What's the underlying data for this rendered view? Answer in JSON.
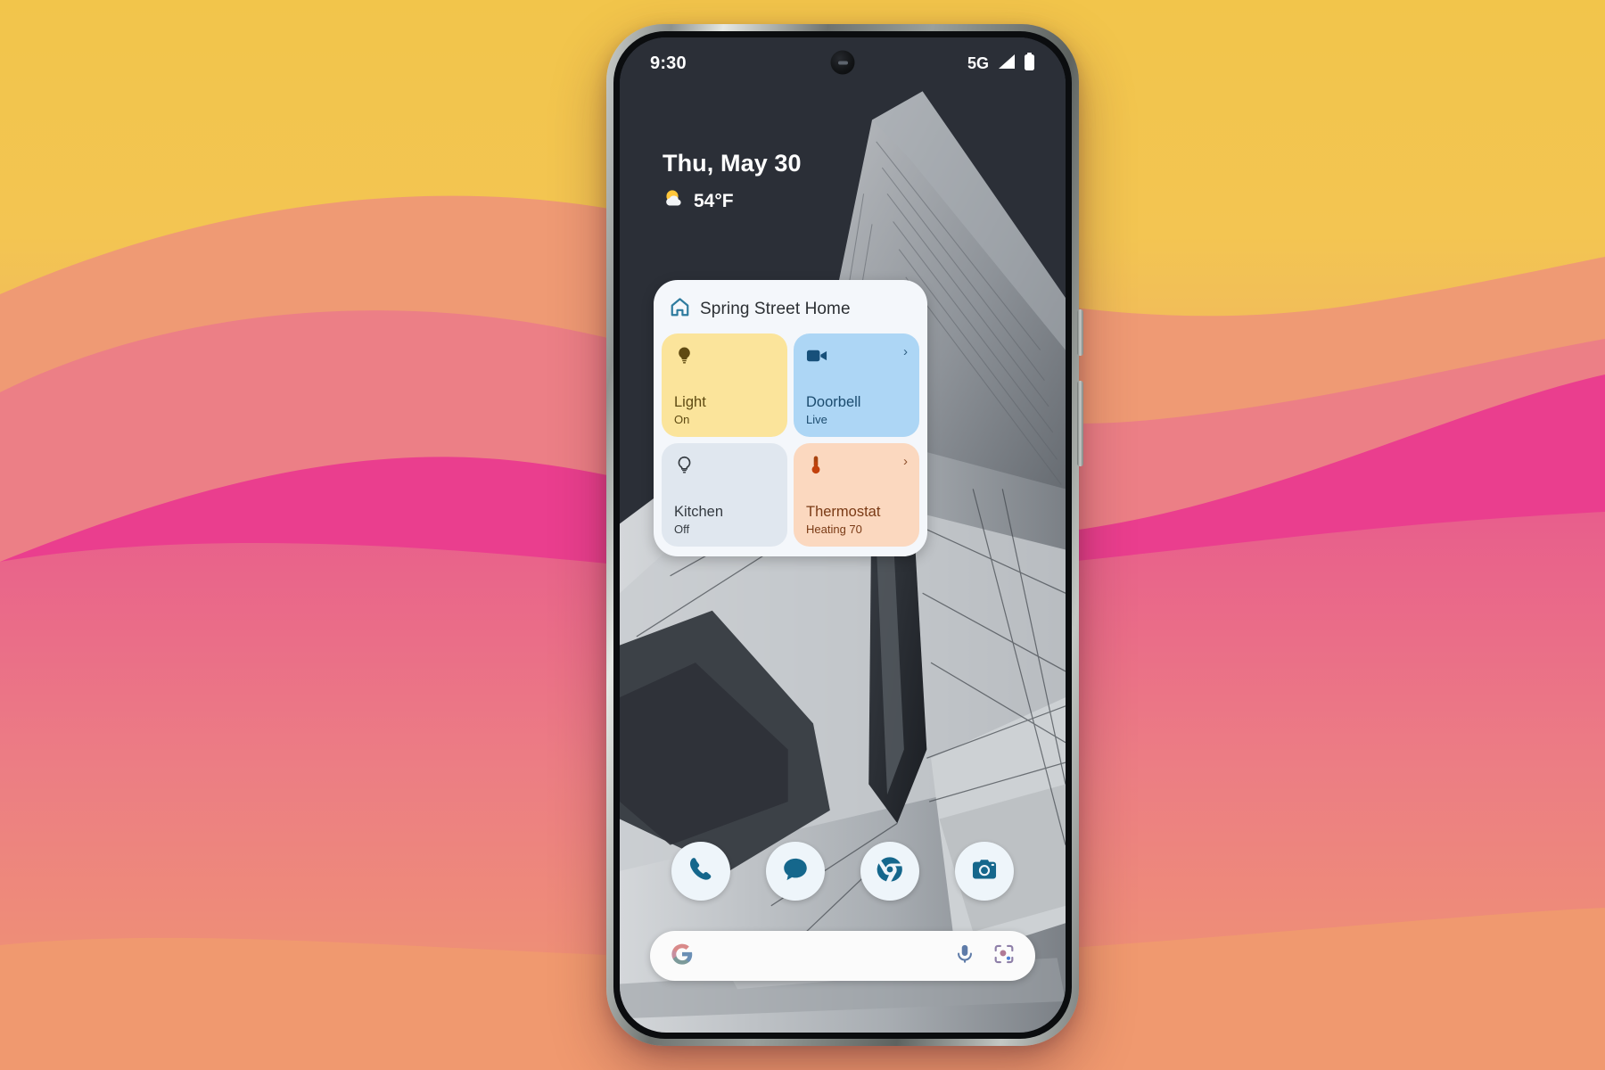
{
  "scene": {
    "background_colors": {
      "sky_top": "#F2C54B",
      "sky_mid": "#F0B264",
      "wave_salmon": "#EF9A74",
      "wave_coral": "#EC7F86",
      "wave_pink": "#E85E8C",
      "wave_magenta": "#EA3E8E",
      "wave_bottom": "#F0996F"
    }
  },
  "status_bar": {
    "time": "9:30",
    "network_label": "5G",
    "signal_icon": "signal-bars-icon",
    "battery_icon": "battery-full-icon",
    "camera_icon": "front-camera-icon"
  },
  "at_a_glance": {
    "date": "Thu, May 30",
    "temperature": "54°F",
    "weather_icon": "sun-behind-cloud-icon"
  },
  "home_widget": {
    "icon": "google-home-icon",
    "title": "Spring Street Home",
    "tiles": [
      {
        "name": "Light",
        "state": "On",
        "icon": "lightbulb-filled-icon",
        "chevron": "",
        "has_chevron": false,
        "bg": "#FBE49B",
        "fg": "#5F4A12"
      },
      {
        "name": "Doorbell",
        "state": "Live",
        "icon": "video-camera-icon",
        "chevron": "›",
        "has_chevron": true,
        "bg": "#ADD6F5",
        "fg": "#1B4B6E"
      },
      {
        "name": "Kitchen",
        "state": "Off",
        "icon": "lightbulb-outline-icon",
        "chevron": "",
        "has_chevron": false,
        "bg": "#E0E7EF",
        "fg": "#343A40"
      },
      {
        "name": "Thermostat",
        "state": "Heating 70",
        "icon": "thermometer-icon",
        "chevron": "›",
        "has_chevron": true,
        "bg": "#FBD8BF",
        "fg": "#7A3A15"
      }
    ]
  },
  "dock": {
    "icon_color": "#15678C",
    "items": [
      {
        "label": "Phone",
        "icon": "phone-icon"
      },
      {
        "label": "Messages",
        "icon": "messages-icon"
      },
      {
        "label": "Chrome",
        "icon": "chrome-icon"
      },
      {
        "label": "Camera",
        "icon": "camera-icon"
      }
    ]
  },
  "search_bar": {
    "logo": "google-g-icon",
    "query": "",
    "placeholder": "",
    "mic_icon": "microphone-icon",
    "lens_icon": "google-lens-icon"
  }
}
